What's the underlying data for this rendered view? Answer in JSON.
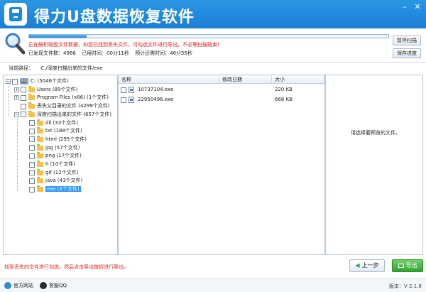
{
  "app": {
    "title": "得力U盘数据恢复软件",
    "minimize_label": "–",
    "close_label": "✕"
  },
  "scan": {
    "progress": 0.16,
    "status_red": "正在解析磁盘文件数据，如您已找到丢失文件，可勾选文件进行导出，不必等扫描结束!",
    "found_label": "已发现文件数：4966",
    "elapsed_label": "已用时间：00分11秒",
    "remaining_label": "预计还需时间：46分55秒",
    "pause_label": "暂停扫描",
    "save_label": "保存进度"
  },
  "path": {
    "label": "当前路径：",
    "value": "C:/深度扫描出来的文件/exe"
  },
  "tree": {
    "items": [
      {
        "label": "C:  (5046个文件)",
        "type": "drive",
        "expander": "−"
      },
      {
        "label": "Users  (89个文件)",
        "type": "folder",
        "expander": "+"
      },
      {
        "label": "Program Files (x86)  (1个文件)",
        "type": "folder",
        "expander": "+"
      },
      {
        "label": "丢失父目录的文件  (4299个文件)",
        "type": "folder",
        "expander": ""
      },
      {
        "label": "深度扫描出来的文件  (657个文件)",
        "type": "folder",
        "expander": "−"
      },
      {
        "label": "dll  (33个文件)",
        "type": "folder",
        "expander": ""
      },
      {
        "label": "txt  (188个文件)",
        "type": "folder",
        "expander": ""
      },
      {
        "label": "html  (295个文件)",
        "type": "folder",
        "expander": ""
      },
      {
        "label": "jpg  (57个文件)",
        "type": "folder",
        "expander": ""
      },
      {
        "label": "png  (17个文件)",
        "type": "folder",
        "expander": ""
      },
      {
        "label": "h  (10个文件)",
        "type": "folder",
        "expander": ""
      },
      {
        "label": "gif  (12个文件)",
        "type": "folder",
        "expander": ""
      },
      {
        "label": "java  (43个文件)",
        "type": "folder",
        "expander": ""
      },
      {
        "label": "exe  (2个文件)",
        "type": "folder",
        "expander": "",
        "selected": true
      }
    ]
  },
  "list": {
    "headers": {
      "name": "名称",
      "date": "修改日期",
      "size": "大小"
    },
    "rows": [
      {
        "name": "10737104.exe",
        "date": "",
        "size": "220 KB"
      },
      {
        "name": "22950496.exe",
        "date": "",
        "size": "668 KB"
      }
    ]
  },
  "preview": {
    "text": "请选择要预览的文件。"
  },
  "bottom": {
    "hint": "找到丢失的文件进行勾选，然后点击导出按钮进行导出。",
    "prev_label": "上一步",
    "prev_arrow": "◀",
    "export_label": "导出"
  },
  "footer": {
    "site_label": "官方网站",
    "qq_label": "客服QQ",
    "version": "版本：V 2.1.8"
  },
  "colors": {
    "titlebar": "#1a7fd4",
    "status_red": "#e02020",
    "export_green": "#31a52f",
    "selection": "#3399ff"
  }
}
